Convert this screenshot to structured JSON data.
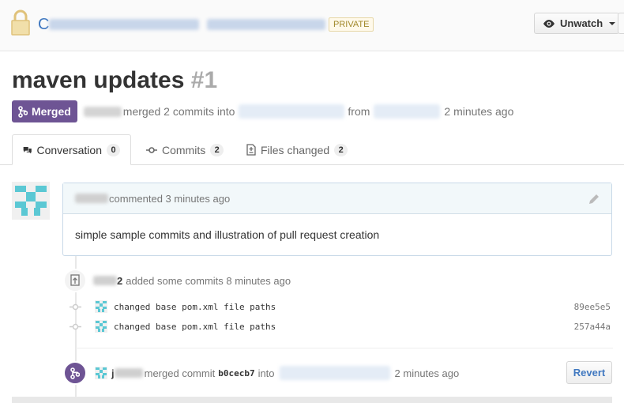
{
  "repo": {
    "name_prefix": "C",
    "badge": "PRIVATE"
  },
  "watch": {
    "label": "Unwatch"
  },
  "pr": {
    "title": "maven updates",
    "number": "#1",
    "state": "Merged",
    "meta_merged_text": "merged 2 commits into",
    "meta_from": "from",
    "meta_time": "2 minutes ago"
  },
  "tabs": [
    {
      "label": "Conversation",
      "count": "0"
    },
    {
      "label": "Commits",
      "count": "2"
    },
    {
      "label": "Files changed",
      "count": "2"
    }
  ],
  "comment": {
    "header": "commented 3 minutes ago",
    "body": "simple sample commits and illustration of pull request creation"
  },
  "commits_event": {
    "user_suffix": "2",
    "text": "added some commits 8 minutes ago",
    "commits": [
      {
        "message": "changed base pom.xml file paths",
        "sha": "89ee5e5"
      },
      {
        "message": "changed base pom.xml file paths",
        "sha": "257a44a"
      }
    ]
  },
  "merge_event": {
    "user_prefix": "j",
    "text": "merged commit",
    "sha": "b0cecb7",
    "into": "into",
    "time": "2 minutes ago",
    "revert_label": "Revert"
  },
  "colors": {
    "merged": "#6e5494",
    "link": "#4078c0",
    "identicon": "#5bc8d4"
  }
}
